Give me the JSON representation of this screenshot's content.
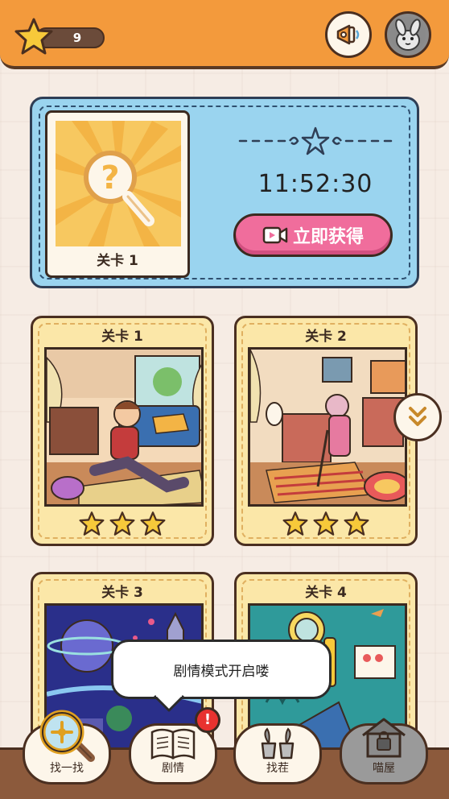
{
  "header": {
    "star_count": "9",
    "colors": {
      "bar": "#f39a3c",
      "star": "#f7c93a"
    }
  },
  "timed_level": {
    "card_label": "关卡 1",
    "countdown": "11:52:30",
    "button_label": "立即获得",
    "colors": {
      "panel": "#9ad4ef",
      "button": "#f06d9c"
    }
  },
  "levels": [
    {
      "title": "关卡 1",
      "stars": 3
    },
    {
      "title": "关卡 2",
      "stars": 3
    },
    {
      "title": "关卡 3"
    },
    {
      "title": "关卡 4"
    }
  ],
  "toast": {
    "text": "剧情模式开启喽"
  },
  "nav": {
    "items": [
      {
        "label": "找一找",
        "icon": "magnifier-icon"
      },
      {
        "label": "剧情",
        "icon": "book-icon",
        "badge": "!"
      },
      {
        "label": "找茬",
        "icon": "plant-pots-icon"
      },
      {
        "label": "喵屋",
        "icon": "locked-house-icon"
      }
    ]
  }
}
